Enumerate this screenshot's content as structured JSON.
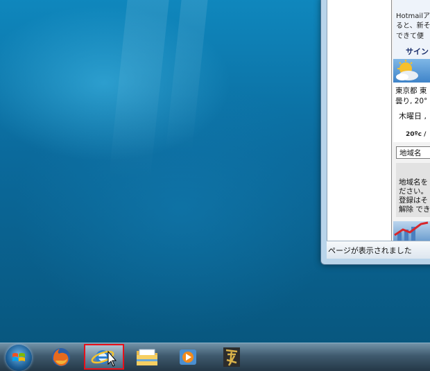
{
  "ie_window": {
    "status_text": "ページが表示されました",
    "hotmail_lines": [
      "Hotmailア",
      "ると、新そ",
      "できて便"
    ],
    "signin_label": "サイン",
    "weather": {
      "city": "東京都 東",
      "condition": "曇り, 20°",
      "day": "木曜日 ,",
      "temp": "20ºc /"
    },
    "region_input_value": "地域名",
    "region_note_lines": [
      "地域名を",
      "ださい。",
      "登録はそ",
      "解除 でき"
    ]
  },
  "taskbar": {
    "items": [
      "start",
      "firefox",
      "internet-explorer",
      "windows-explorer",
      "media-player",
      "app"
    ],
    "highlight_color": "#e8101a"
  }
}
